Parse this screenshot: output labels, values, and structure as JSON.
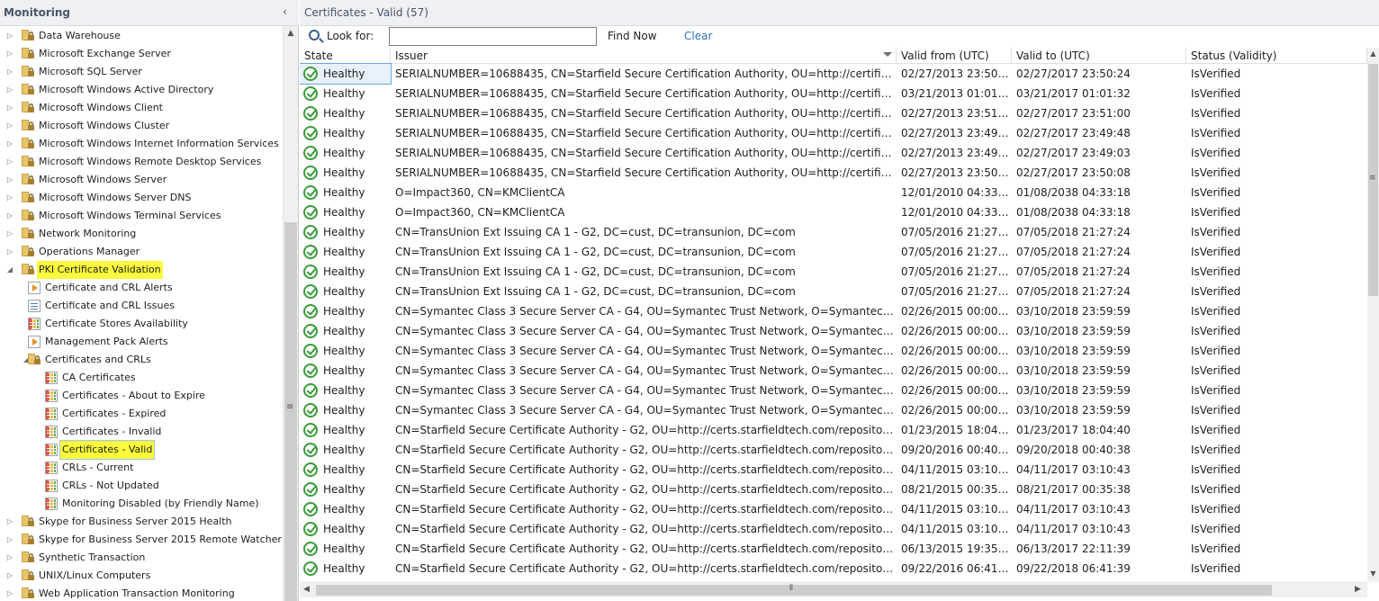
{
  "left_pane": {
    "title": "Monitoring",
    "collapse_glyph": "‹",
    "tree": [
      {
        "label": "Data Warehouse",
        "level": 0,
        "icon": "folder-lock-icon",
        "expander": "▷"
      },
      {
        "label": "Microsoft Exchange Server",
        "level": 0,
        "icon": "folder-lock-icon",
        "expander": "▷"
      },
      {
        "label": "Microsoft SQL Server",
        "level": 0,
        "icon": "folder-lock-icon",
        "expander": "▷"
      },
      {
        "label": "Microsoft Windows Active Directory",
        "level": 0,
        "icon": "folder-lock-icon",
        "expander": "▷"
      },
      {
        "label": "Microsoft Windows Client",
        "level": 0,
        "icon": "folder-lock-icon",
        "expander": "▷"
      },
      {
        "label": "Microsoft Windows Cluster",
        "level": 0,
        "icon": "folder-lock-icon",
        "expander": "▷"
      },
      {
        "label": "Microsoft Windows Internet Information Services",
        "level": 0,
        "icon": "folder-lock-icon",
        "expander": "▷"
      },
      {
        "label": "Microsoft Windows Remote Desktop Services",
        "level": 0,
        "icon": "folder-lock-icon",
        "expander": "▷"
      },
      {
        "label": "Microsoft Windows Server",
        "level": 0,
        "icon": "folder-lock-icon",
        "expander": "▷"
      },
      {
        "label": "Microsoft Windows Server DNS",
        "level": 0,
        "icon": "folder-lock-icon",
        "expander": "▷"
      },
      {
        "label": "Microsoft Windows Terminal Services",
        "level": 0,
        "icon": "folder-lock-icon",
        "expander": "▷"
      },
      {
        "label": "Network Monitoring",
        "level": 0,
        "icon": "folder-lock-icon",
        "expander": "▷"
      },
      {
        "label": "Operations Manager",
        "level": 0,
        "icon": "folder-lock-icon",
        "expander": "▷"
      },
      {
        "label": "PKI Certificate Validation",
        "level": 0,
        "icon": "folder-lock-icon",
        "expander": "◢",
        "highlight": true
      },
      {
        "label": "Certificate and CRL Alerts",
        "level": 1,
        "icon": "alert-view-icon",
        "expander": ""
      },
      {
        "label": "Certificate and CRL Issues",
        "level": 1,
        "icon": "report-view-icon",
        "expander": ""
      },
      {
        "label": "Certificate Stores Availability",
        "level": 1,
        "icon": "state-view-icon",
        "expander": ""
      },
      {
        "label": "Management Pack Alerts",
        "level": 1,
        "icon": "alert-view-icon",
        "expander": ""
      },
      {
        "label": "Certificates and CRLs",
        "level": 1,
        "icon": "folder-lock-icon",
        "expander": "◢"
      },
      {
        "label": "CA Certificates",
        "level": 2,
        "icon": "state-view-icon",
        "expander": ""
      },
      {
        "label": "Certificates - About to Expire",
        "level": 2,
        "icon": "state-view-icon",
        "expander": ""
      },
      {
        "label": "Certificates - Expired",
        "level": 2,
        "icon": "state-view-icon",
        "expander": ""
      },
      {
        "label": "Certificates - Invalid",
        "level": 2,
        "icon": "state-view-icon",
        "expander": ""
      },
      {
        "label": "Certificates - Valid",
        "level": 2,
        "icon": "state-view-icon",
        "expander": "",
        "highlight": true,
        "selected": true
      },
      {
        "label": "CRLs - Current",
        "level": 2,
        "icon": "state-view-icon",
        "expander": ""
      },
      {
        "label": "CRLs - Not Updated",
        "level": 2,
        "icon": "state-view-icon",
        "expander": ""
      },
      {
        "label": "Monitoring Disabled (by Friendly Name)",
        "level": 2,
        "icon": "state-view-icon",
        "expander": ""
      },
      {
        "label": "Skype for Business Server 2015 Health",
        "level": 0,
        "icon": "folder-lock-icon",
        "expander": "▷"
      },
      {
        "label": "Skype for Business Server 2015 Remote Watcher Health",
        "level": 0,
        "icon": "folder-lock-icon",
        "expander": "▷"
      },
      {
        "label": "Synthetic Transaction",
        "level": 0,
        "icon": "folder-lock-icon",
        "expander": "▷"
      },
      {
        "label": "UNIX/Linux Computers",
        "level": 0,
        "icon": "folder-lock-icon",
        "expander": "▷"
      },
      {
        "label": "Web Application Transaction Monitoring",
        "level": 0,
        "icon": "folder-lock-icon",
        "expander": "▷"
      }
    ]
  },
  "right_pane": {
    "title": "Certificates - Valid (57)",
    "search": {
      "label": "Look for:",
      "value": "",
      "find_now": "Find Now",
      "clear": "Clear"
    },
    "columns": [
      "State",
      "Issuer",
      "Valid from (UTC)",
      "Valid to (UTC)",
      "Status (Validity)"
    ],
    "rows": [
      {
        "state": "Healthy",
        "issuer": "SERIALNUMBER=10688435, CN=Starfield Secure Certification Authority, OU=http://certificates.starfield...",
        "from": "02/27/2013 23:50:24",
        "to": "02/27/2017 23:50:24",
        "status": "IsVerified"
      },
      {
        "state": "Healthy",
        "issuer": "SERIALNUMBER=10688435, CN=Starfield Secure Certification Authority, OU=http://certificates.starfield...",
        "from": "03/21/2013 01:01:32",
        "to": "03/21/2017 01:01:32",
        "status": "IsVerified"
      },
      {
        "state": "Healthy",
        "issuer": "SERIALNUMBER=10688435, CN=Starfield Secure Certification Authority, OU=http://certificates.starfield...",
        "from": "02/27/2013 23:51:00",
        "to": "02/27/2017 23:51:00",
        "status": "IsVerified"
      },
      {
        "state": "Healthy",
        "issuer": "SERIALNUMBER=10688435, CN=Starfield Secure Certification Authority, OU=http://certificates.starfield...",
        "from": "02/27/2013 23:49:48",
        "to": "02/27/2017 23:49:48",
        "status": "IsVerified"
      },
      {
        "state": "Healthy",
        "issuer": "SERIALNUMBER=10688435, CN=Starfield Secure Certification Authority, OU=http://certificates.starfield...",
        "from": "02/27/2013 23:49:03",
        "to": "02/27/2017 23:49:03",
        "status": "IsVerified"
      },
      {
        "state": "Healthy",
        "issuer": "SERIALNUMBER=10688435, CN=Starfield Secure Certification Authority, OU=http://certificates.starfield...",
        "from": "02/27/2013 23:50:08",
        "to": "02/27/2017 23:50:08",
        "status": "IsVerified"
      },
      {
        "state": "Healthy",
        "issuer": "O=Impact360, CN=KMClientCA",
        "from": "12/01/2010 04:33:18",
        "to": "01/08/2038 04:33:18",
        "status": "IsVerified"
      },
      {
        "state": "Healthy",
        "issuer": "O=Impact360, CN=KMClientCA",
        "from": "12/01/2010 04:33:18",
        "to": "01/08/2038 04:33:18",
        "status": "IsVerified"
      },
      {
        "state": "Healthy",
        "issuer": "CN=TransUnion Ext Issuing CA 1 - G2, DC=cust, DC=transunion, DC=com",
        "from": "07/05/2016 21:27:24",
        "to": "07/05/2018 21:27:24",
        "status": "IsVerified"
      },
      {
        "state": "Healthy",
        "issuer": "CN=TransUnion Ext Issuing CA 1 - G2, DC=cust, DC=transunion, DC=com",
        "from": "07/05/2016 21:27:24",
        "to": "07/05/2018 21:27:24",
        "status": "IsVerified"
      },
      {
        "state": "Healthy",
        "issuer": "CN=TransUnion Ext Issuing CA 1 - G2, DC=cust, DC=transunion, DC=com",
        "from": "07/05/2016 21:27:24",
        "to": "07/05/2018 21:27:24",
        "status": "IsVerified"
      },
      {
        "state": "Healthy",
        "issuer": "CN=TransUnion Ext Issuing CA 1 - G2, DC=cust, DC=transunion, DC=com",
        "from": "07/05/2016 21:27:24",
        "to": "07/05/2018 21:27:24",
        "status": "IsVerified"
      },
      {
        "state": "Healthy",
        "issuer": "CN=Symantec Class 3 Secure Server CA - G4, OU=Symantec Trust Network, O=Symantec Corporation, ...",
        "from": "02/26/2015 00:00:00",
        "to": "03/10/2018 23:59:59",
        "status": "IsVerified"
      },
      {
        "state": "Healthy",
        "issuer": "CN=Symantec Class 3 Secure Server CA - G4, OU=Symantec Trust Network, O=Symantec Corporation, ...",
        "from": "02/26/2015 00:00:00",
        "to": "03/10/2018 23:59:59",
        "status": "IsVerified"
      },
      {
        "state": "Healthy",
        "issuer": "CN=Symantec Class 3 Secure Server CA - G4, OU=Symantec Trust Network, O=Symantec Corporation, ...",
        "from": "02/26/2015 00:00:00",
        "to": "03/10/2018 23:59:59",
        "status": "IsVerified"
      },
      {
        "state": "Healthy",
        "issuer": "CN=Symantec Class 3 Secure Server CA - G4, OU=Symantec Trust Network, O=Symantec Corporation, ...",
        "from": "02/26/2015 00:00:00",
        "to": "03/10/2018 23:59:59",
        "status": "IsVerified"
      },
      {
        "state": "Healthy",
        "issuer": "CN=Symantec Class 3 Secure Server CA - G4, OU=Symantec Trust Network, O=Symantec Corporation, ...",
        "from": "02/26/2015 00:00:00",
        "to": "03/10/2018 23:59:59",
        "status": "IsVerified"
      },
      {
        "state": "Healthy",
        "issuer": "CN=Symantec Class 3 Secure Server CA - G4, OU=Symantec Trust Network, O=Symantec Corporation, ...",
        "from": "02/26/2015 00:00:00",
        "to": "03/10/2018 23:59:59",
        "status": "IsVerified"
      },
      {
        "state": "Healthy",
        "issuer": "CN=Starfield Secure Certificate Authority - G2, OU=http://certs.starfieldtech.com/repository/, O=\"Starf...",
        "from": "01/23/2015 18:04:40",
        "to": "01/23/2017 18:04:40",
        "status": "IsVerified"
      },
      {
        "state": "Healthy",
        "issuer": "CN=Starfield Secure Certificate Authority - G2, OU=http://certs.starfieldtech.com/repository/, O=\"Starf...",
        "from": "09/20/2016 00:40:38",
        "to": "09/20/2018 00:40:38",
        "status": "IsVerified"
      },
      {
        "state": "Healthy",
        "issuer": "CN=Starfield Secure Certificate Authority - G2, OU=http://certs.starfieldtech.com/repository/, O=\"Starf...",
        "from": "04/11/2015 03:10:43",
        "to": "04/11/2017 03:10:43",
        "status": "IsVerified"
      },
      {
        "state": "Healthy",
        "issuer": "CN=Starfield Secure Certificate Authority - G2, OU=http://certs.starfieldtech.com/repository/, O=\"Starf...",
        "from": "08/21/2015 00:35:38",
        "to": "08/21/2017 00:35:38",
        "status": "IsVerified"
      },
      {
        "state": "Healthy",
        "issuer": "CN=Starfield Secure Certificate Authority - G2, OU=http://certs.starfieldtech.com/repository/, O=\"Starf...",
        "from": "04/11/2015 03:10:43",
        "to": "04/11/2017 03:10:43",
        "status": "IsVerified"
      },
      {
        "state": "Healthy",
        "issuer": "CN=Starfield Secure Certificate Authority - G2, OU=http://certs.starfieldtech.com/repository/, O=\"Starf...",
        "from": "04/11/2015 03:10:43",
        "to": "04/11/2017 03:10:43",
        "status": "IsVerified"
      },
      {
        "state": "Healthy",
        "issuer": "CN=Starfield Secure Certificate Authority - G2, OU=http://certs.starfieldtech.com/repository/, O=\"Starf...",
        "from": "06/13/2015 19:35:38",
        "to": "06/13/2017 22:11:39",
        "status": "IsVerified"
      },
      {
        "state": "Healthy",
        "issuer": "CN=Starfield Secure Certificate Authority - G2, OU=http://certs.starfieldtech.com/repository/, O=\"Starf...",
        "from": "09/22/2016 06:41:39",
        "to": "09/22/2018 06:41:39",
        "status": "IsVerified"
      }
    ]
  },
  "colors": {
    "highlight": "#fbfb3c",
    "healthy": "#3a9b3a",
    "link": "#2f6fb3",
    "header_bg": "#eef0f4"
  }
}
